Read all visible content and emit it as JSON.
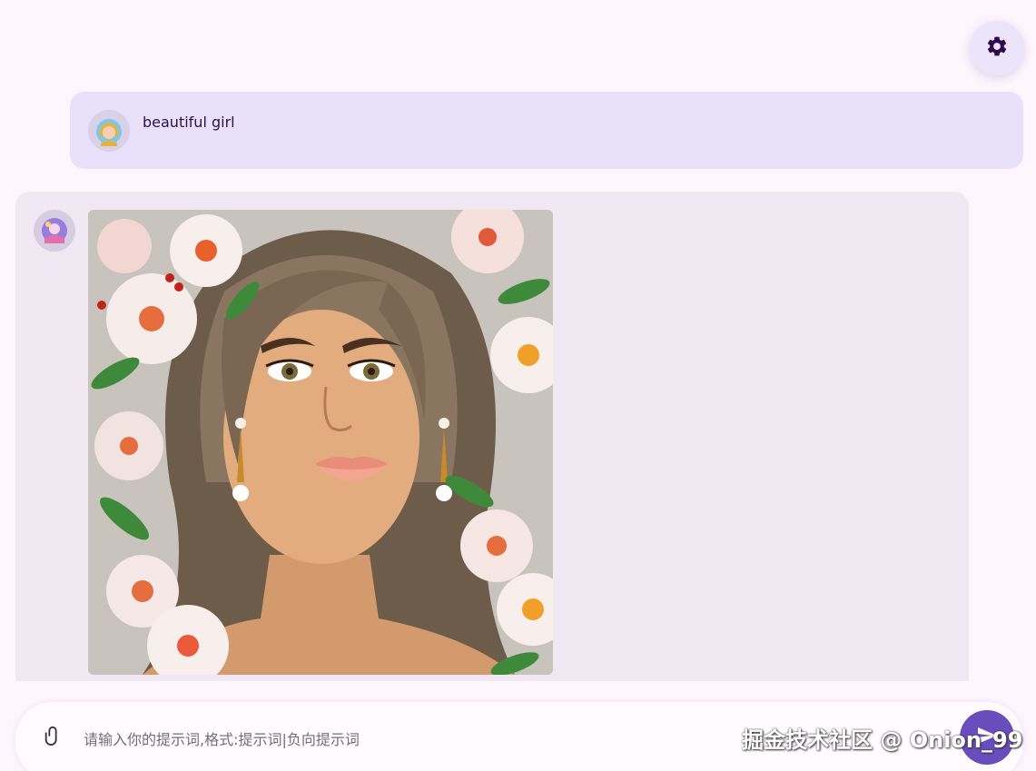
{
  "settings": {
    "icon": "gear-icon"
  },
  "user_message": {
    "avatar_icon": "user-avatar",
    "text": "beautiful girl"
  },
  "bot_message": {
    "avatar_icon": "bot-avatar",
    "image_icon": "generated-portrait-image"
  },
  "composer": {
    "attach_icon": "paperclip-icon",
    "placeholder": "请输入你的提示词,格式:提示词|负向提示词",
    "send_icon": "send-icon"
  },
  "watermark": "掘金技术社区 @ Onion_99",
  "colors": {
    "accent": "#6a4dbd",
    "user_bubble": "#e9e0fb",
    "bot_bubble": "#f1e8f3",
    "page_bg": "#fdf6fd"
  }
}
